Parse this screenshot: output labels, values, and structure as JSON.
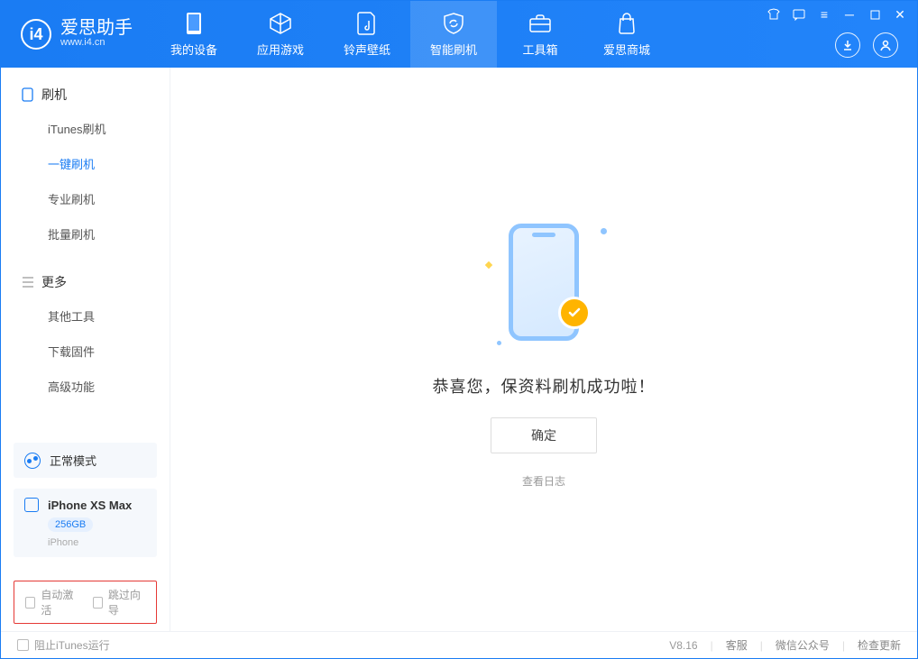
{
  "app": {
    "name_cn": "爱思助手",
    "name_en": "www.i4.cn"
  },
  "nav": {
    "my_device": "我的设备",
    "apps_games": "应用游戏",
    "ring_wall": "铃声壁纸",
    "smart_flash": "智能刷机",
    "toolbox": "工具箱",
    "i4_mall": "爱思商城"
  },
  "sidebar": {
    "section_flash": "刷机",
    "items_flash": {
      "itunes": "iTunes刷机",
      "oneclick": "一键刷机",
      "pro": "专业刷机",
      "batch": "批量刷机"
    },
    "section_more": "更多",
    "items_more": {
      "other_tools": "其他工具",
      "download_fw": "下载固件",
      "advanced": "高级功能"
    }
  },
  "device": {
    "mode": "正常模式",
    "name": "iPhone XS Max",
    "capacity": "256GB",
    "type": "iPhone"
  },
  "options": {
    "auto_activate": "自动激活",
    "skip_wizard": "跳过向导"
  },
  "main": {
    "success_text": "恭喜您，保资料刷机成功啦！",
    "ok": "确定",
    "view_log": "查看日志"
  },
  "footer": {
    "block_itunes": "阻止iTunes运行",
    "version": "V8.16",
    "support": "客服",
    "wechat": "微信公众号",
    "check_update": "检查更新"
  }
}
